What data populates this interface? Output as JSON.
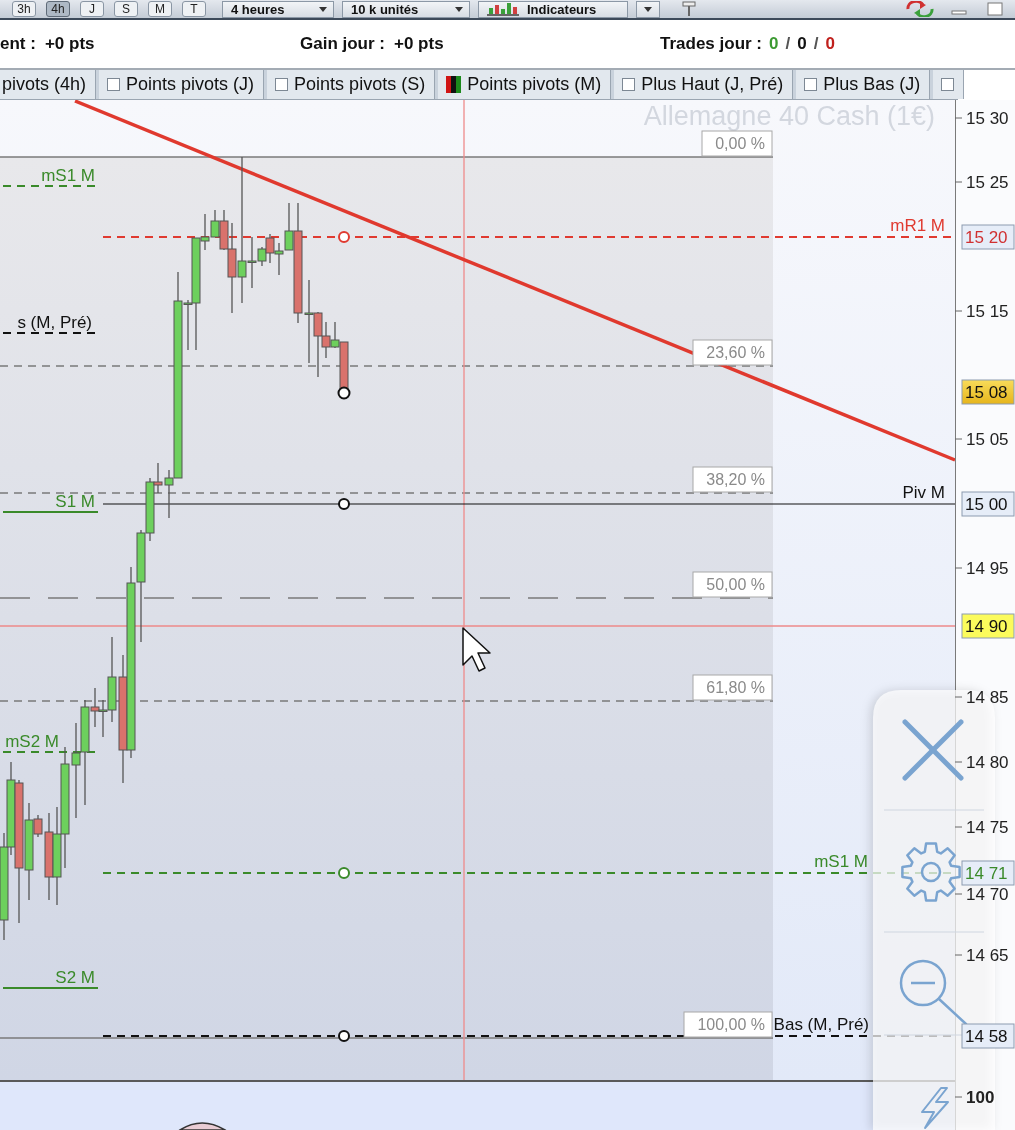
{
  "toolbar": {
    "periods": [
      {
        "label": "3h",
        "selected": false
      },
      {
        "label": "4h",
        "selected": true
      },
      {
        "label": "J",
        "selected": false
      },
      {
        "label": "S",
        "selected": false
      },
      {
        "label": "M",
        "selected": false
      },
      {
        "label": "T",
        "selected": false
      }
    ],
    "dropdowns": [
      {
        "label": "4 heures"
      },
      {
        "label": "10 k unités"
      }
    ],
    "indicators_button": {
      "label": "Indicateurs"
    }
  },
  "info_bar": {
    "stats": [
      {
        "label": "ent :",
        "value": "+0 pts"
      },
      {
        "label": "Gain jour :",
        "value": "+0 pts"
      }
    ],
    "trades": {
      "label": "Trades jour :",
      "separator": "/",
      "counts": [
        {
          "value": "0",
          "color": "#3c9a32"
        },
        {
          "value": "0",
          "color": "#111111"
        },
        {
          "value": "0",
          "color": "#c0201c"
        }
      ]
    }
  },
  "indicator_tabs": [
    {
      "label": "pivots (4h)"
    },
    {
      "label": "Points pivots (J)",
      "checked": false
    },
    {
      "label": "Points pivots (S)",
      "checked": false
    },
    {
      "label": "Points pivots (M)",
      "checked": true
    },
    {
      "label": "Plus Haut (J, Pré)",
      "checked": false
    },
    {
      "label": "Plus Bas (J)",
      "checked": false
    },
    {
      "checked": false
    }
  ],
  "chart": {
    "instrument_title": "Allemagne 40 Cash (1€)",
    "fibonacci_levels": [
      {
        "label": "0,00 %"
      },
      {
        "label": "23,60 %"
      },
      {
        "label": "38,20 %"
      },
      {
        "label": "50,00 %"
      },
      {
        "label": "61,80 %"
      },
      {
        "label": "100,00 %"
      }
    ],
    "pivot_lines": [
      {
        "label": "mS1 M",
        "kind": "stub",
        "color": "#3a8a2a"
      },
      {
        "label": "mR1 M",
        "kind": "ray",
        "color": "#e03a30"
      },
      {
        "label": "s (M, Pré)",
        "kind": "stub",
        "color": "#111111"
      },
      {
        "label": "Piv M",
        "kind": "ray",
        "color": "#111111"
      },
      {
        "label": "S1 M",
        "kind": "stub",
        "color": "#3a8a2a"
      },
      {
        "label": "mS2 M",
        "kind": "stub",
        "color": "#3a8a2a"
      },
      {
        "label": "mS1 M",
        "kind": "ray",
        "color": "#3a8a2a"
      },
      {
        "label": "S2 M",
        "kind": "stub",
        "color": "#3a8a2a"
      },
      {
        "label": "Bas (M, Pré)",
        "kind": "ray",
        "color": "#111111"
      }
    ],
    "price_axis": {
      "ticks": [
        "15 30",
        "15 25",
        "15 15",
        "15 05",
        "14 95",
        "14 85",
        "14 80",
        "14 75",
        "14 70",
        "14 65"
      ],
      "markers": [
        {
          "label": "15 20",
          "kind": "level",
          "color": "#d03030"
        },
        {
          "label": "15 08",
          "kind": "last_price",
          "color": "#111111"
        },
        {
          "label": "15 00",
          "kind": "level",
          "color": "#111111"
        },
        {
          "label": "14 90",
          "kind": "crosshair",
          "color": "#111111"
        },
        {
          "label": "14 71",
          "kind": "level",
          "color": "#3a8a2a"
        },
        {
          "label": "14 58",
          "kind": "level",
          "color": "#111111"
        }
      ]
    },
    "lower_panel": {
      "axis_ticks": [
        "100"
      ]
    }
  }
}
